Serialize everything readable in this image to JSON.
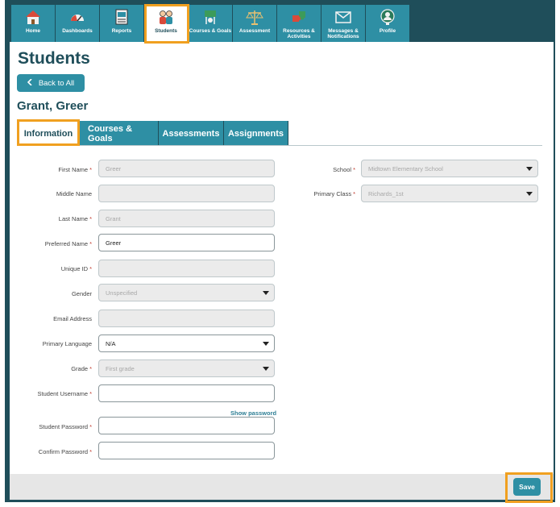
{
  "nav": {
    "items": [
      {
        "label": "Home",
        "icon": "home-icon"
      },
      {
        "label": "Dashboards",
        "icon": "gauge-icon"
      },
      {
        "label": "Reports",
        "icon": "report-icon"
      },
      {
        "label": "Students",
        "icon": "students-icon"
      },
      {
        "label": "Courses & Goals",
        "icon": "courses-icon"
      },
      {
        "label": "Assessment",
        "icon": "scale-icon"
      },
      {
        "label": "Resources & Activities",
        "icon": "puzzle-icon"
      },
      {
        "label": "Messages & Notifications",
        "icon": "envelope-icon"
      },
      {
        "label": "Profile",
        "icon": "profile-icon"
      }
    ],
    "active": "Students"
  },
  "page": {
    "title": "Students",
    "back_label": "Back to All",
    "student_name": "Grant, Greer"
  },
  "tabs": [
    "Information",
    "Courses & Goals",
    "Assessments",
    "Assignments"
  ],
  "form": {
    "first_name": {
      "label": "First Name",
      "value": "Greer"
    },
    "middle_name": {
      "label": "Middle Name",
      "value": ""
    },
    "last_name": {
      "label": "Last Name",
      "value": "Grant"
    },
    "preferred_name": {
      "label": "Preferred Name",
      "value": "Greer"
    },
    "unique_id": {
      "label": "Unique ID",
      "value": ""
    },
    "gender": {
      "label": "Gender",
      "value": "Unspecified"
    },
    "email": {
      "label": "Email Address",
      "value": ""
    },
    "primary_language": {
      "label": "Primary Language",
      "value": "N/A"
    },
    "grade": {
      "label": "Grade",
      "value": "First grade"
    },
    "student_username": {
      "label": "Student Username",
      "value": ""
    },
    "show_password": "Show password",
    "student_password": {
      "label": "Student Password",
      "value": ""
    },
    "confirm_password": {
      "label": "Confirm Password",
      "value": ""
    },
    "school": {
      "label": "School",
      "value": "Midtown Elementary School"
    },
    "primary_class": {
      "label": "Primary Class",
      "value": "Richards_1st"
    },
    "required_mark": "*"
  },
  "footer": {
    "save_label": "Save"
  },
  "colors": {
    "primary": "#2e8fa4",
    "dark": "#1f4e5a",
    "highlight": "#f0a020"
  }
}
